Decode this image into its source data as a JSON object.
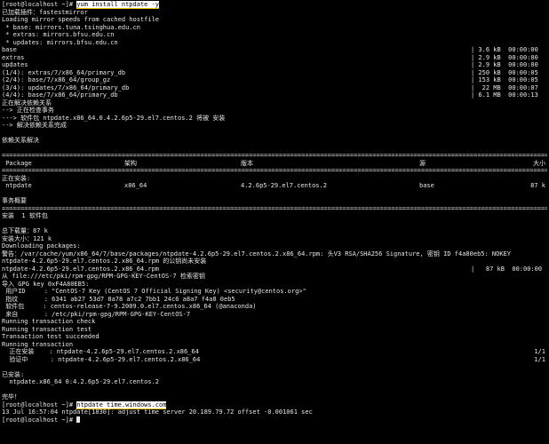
{
  "lines": [
    {
      "kind": "cmd",
      "prompt": "[root@localhost ~]# ",
      "cmd": "yum install ntpdate -y"
    },
    {
      "kind": "text",
      "text": "已加载插件：fastestmirror"
    },
    {
      "kind": "text",
      "text": "Loading mirror speeds from cached hostfile"
    },
    {
      "kind": "text",
      "text": " * base: mirrors.tuna.tsinghua.edu.cn"
    },
    {
      "kind": "text",
      "text": " * extras: mirrors.bfsu.edu.cn"
    },
    {
      "kind": "text",
      "text": " * updates: mirrors.bfsu.edu.cn"
    },
    {
      "kind": "repo",
      "name": "base",
      "size": "3.6 kB",
      "time": "00:00:00"
    },
    {
      "kind": "repo",
      "name": "extras",
      "size": "2.9 kB",
      "time": "00:00:00"
    },
    {
      "kind": "repo",
      "name": "updates",
      "size": "2.9 kB",
      "time": "00:00:00"
    },
    {
      "kind": "repo",
      "name": "(1/4): extras/7/x86_64/primary_db",
      "size": "250 kB",
      "time": "00:00:05"
    },
    {
      "kind": "repo",
      "name": "(2/4): base/7/x86_64/group_gz",
      "size": "153 kB",
      "time": "00:00:05"
    },
    {
      "kind": "repo",
      "name": "(3/4): updates/7/x86_64/primary_db",
      "size": "22 MB",
      "time": "00:00:07"
    },
    {
      "kind": "repo",
      "name": "(4/4): base/7/x86_64/primary_db",
      "size": "6.1 MB",
      "time": "00:00:13"
    },
    {
      "kind": "text",
      "text": "正在解决依赖关系"
    },
    {
      "kind": "text",
      "text": "--> 正在检查事务"
    },
    {
      "kind": "text",
      "text": "---> 软件包 ntpdate.x86_64.0.4.2.6p5-29.el7.centos.2 将被 安装"
    },
    {
      "kind": "text",
      "text": "--> 解决依赖关系完成"
    },
    {
      "kind": "blank"
    },
    {
      "kind": "text",
      "text": "依赖关系解决"
    },
    {
      "kind": "blank"
    },
    {
      "kind": "rule",
      "char": "="
    },
    {
      "kind": "table",
      "c1": " Package",
      "c2": "架构",
      "c3": "版本",
      "c4": "源",
      "c5": "大小"
    },
    {
      "kind": "rule",
      "char": "="
    },
    {
      "kind": "text",
      "text": "正在安装:"
    },
    {
      "kind": "table",
      "c1": " ntpdate",
      "c2": "x86_64",
      "c3": "4.2.6p5-29.el7.centos.2",
      "c4": "base",
      "c5": "87 k"
    },
    {
      "kind": "blank"
    },
    {
      "kind": "text",
      "text": "事务概要"
    },
    {
      "kind": "rule",
      "char": "="
    },
    {
      "kind": "text",
      "text": "安装  1 软件包"
    },
    {
      "kind": "blank"
    },
    {
      "kind": "text",
      "text": "总下载量：87 k"
    },
    {
      "kind": "text",
      "text": "安装大小：121 k"
    },
    {
      "kind": "text",
      "text": "Downloading packages:"
    },
    {
      "kind": "text",
      "text": "警告：/var/cache/yum/x86_64/7/base/packages/ntpdate-4.2.6p5-29.el7.centos.2.x86_64.rpm: 头V3 RSA/SHA256 Signature, 密钥 ID f4a80eb5: NOKEY"
    },
    {
      "kind": "text",
      "text": "ntpdate-4.2.6p5-29.el7.centos.2.x86_64.rpm 的公钥尚未安装"
    },
    {
      "kind": "pkg",
      "name": "ntpdate-4.2.6p5-29.el7.centos.2.x86_64.rpm",
      "size": "87 kB",
      "time": "00:00:00"
    },
    {
      "kind": "text",
      "text": "从 file:///etc/pki/rpm-gpg/RPM-GPG-KEY-CentOS-7 检索密钥"
    },
    {
      "kind": "text",
      "text": "导入 GPG key 0xF4A80EB5:"
    },
    {
      "kind": "text",
      "text": " 用户ID     : \"CentOS-7 Key (CentOS 7 Official Signing Key) <security@centos.org>\""
    },
    {
      "kind": "text",
      "text": " 指纹       : 6341 ab27 53d7 8a78 a7c2 7bb1 24c6 a8a7 f4a8 0eb5"
    },
    {
      "kind": "text",
      "text": " 软件包     : centos-release-7-9.2009.0.el7.centos.x86_64 (@anaconda)"
    },
    {
      "kind": "text",
      "text": " 来自       : /etc/pki/rpm-gpg/RPM-GPG-KEY-CentOS-7"
    },
    {
      "kind": "text",
      "text": "Running transaction check"
    },
    {
      "kind": "text",
      "text": "Running transaction test"
    },
    {
      "kind": "text",
      "text": "Transaction test succeeded"
    },
    {
      "kind": "text",
      "text": "Running transaction"
    },
    {
      "kind": "step",
      "text": "  正在安装    : ntpdate-4.2.6p5-29.el7.centos.2.x86_64",
      "count": "1/1"
    },
    {
      "kind": "step",
      "text": "  验证中      : ntpdate-4.2.6p5-29.el7.centos.2.x86_64",
      "count": "1/1"
    },
    {
      "kind": "blank"
    },
    {
      "kind": "text",
      "text": "已安装:"
    },
    {
      "kind": "text",
      "text": "  ntpdate.x86_64 0:4.2.6p5-29.el7.centos.2"
    },
    {
      "kind": "blank"
    },
    {
      "kind": "text",
      "text": "完毕！"
    },
    {
      "kind": "cmd",
      "prompt": "[root@localhost ~]# ",
      "cmd": "ntpdate time.windows.com"
    },
    {
      "kind": "text",
      "text": "13 Jul 16:57:04 ntpdate[1830]: adjust time server 20.189.79.72 offset -0.001061 sec"
    },
    {
      "kind": "prompt",
      "prompt": "[root@localhost ~]# "
    }
  ],
  "colors": {
    "background": "#000000",
    "foreground": "#e6e6e6",
    "highlight": "#ffffff",
    "underline": "#f2c200"
  }
}
